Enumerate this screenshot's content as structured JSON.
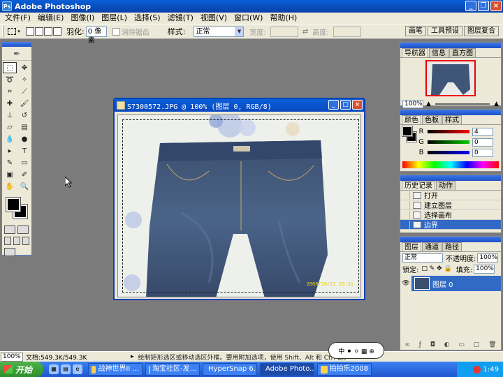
{
  "app": {
    "title": "Adobe Photoshop"
  },
  "menu": [
    "文件(F)",
    "编辑(E)",
    "图像(I)",
    "图层(L)",
    "选择(S)",
    "滤镜(T)",
    "视图(V)",
    "窗口(W)",
    "帮助(H)"
  ],
  "options": {
    "feather_label": "羽化:",
    "feather_value": "0 像素",
    "antialias_label": "消除锯齿",
    "style_label": "样式:",
    "style_value": "正常",
    "width_label": "宽度:",
    "height_label": "高度:",
    "right_tabs": [
      "画笔",
      "工具预设",
      "图层复合"
    ]
  },
  "document": {
    "title": "S7300572.JPG @ 100% (图层 0, RGB/8)",
    "photo_stamp": "2008/10/13 15:31"
  },
  "navigator": {
    "tabs": [
      "导航器",
      "信息",
      "直方图"
    ],
    "zoom": "100%"
  },
  "color_panel": {
    "tabs": [
      "颜色",
      "色板",
      "样式"
    ],
    "r_label": "R",
    "g_label": "G",
    "b_label": "B",
    "r_value": "4",
    "g_value": "0",
    "b_value": "0"
  },
  "history": {
    "tabs": [
      "历史记录",
      "动作"
    ],
    "items": [
      "打开",
      "建立图层",
      "选择画布",
      "边界"
    ]
  },
  "layers": {
    "tabs": [
      "图层",
      "通道",
      "路径"
    ],
    "blend_mode": "正常",
    "opacity_label": "不透明度:",
    "opacity_value": "100%",
    "lock_label": "锁定:",
    "fill_label": "填充:",
    "fill_value": "100%",
    "layer_name": "图层 0"
  },
  "status": {
    "zoom": "100%",
    "doc_size": "文档:549.3K/549.3K",
    "hint": "绘制矩形选区或移动选区外框。要用附加选项，使用 Shift、Alt 和 Ctrl 键。"
  },
  "taskbar": {
    "start": "开始",
    "tasks": [
      "战神世界II ...",
      "淘宝社区-发...",
      "HyperSnap 6...",
      "Adobe Photo...",
      "拍拍乐2008"
    ],
    "active_task": 3,
    "clock": "1:49"
  },
  "tray_bubble": "中 ⚫ ⚪ ▦ ⊕"
}
